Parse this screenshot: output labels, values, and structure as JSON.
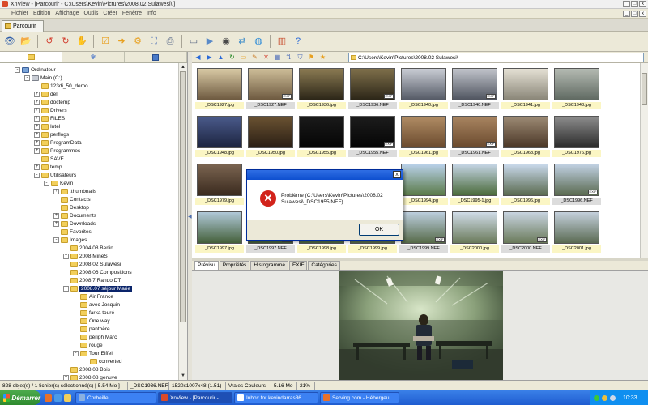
{
  "window": {
    "title": "XnView - [Parcourir - C:\\Users\\Kevin\\Pictures\\2008.02 Sulawesi\\.]",
    "min": "_",
    "max": "□",
    "close": "x"
  },
  "menu": [
    "Fichier",
    "Edition",
    "Affichage",
    "Outils",
    "Créer",
    "Fenêtre",
    "Info"
  ],
  "tab": {
    "label": "Parcourir"
  },
  "toolbar_icons": [
    "eye-icon",
    "folder-open-icon",
    "rotate-left-icon",
    "rotate-right-icon",
    "hand-icon",
    "checklist-icon",
    "folder-arrow-icon",
    "gear-icon",
    "fullscreen-icon",
    "printer-icon",
    "scanner-icon",
    "slideshow-icon",
    "camera-icon",
    "convert-icon",
    "globe-icon",
    "panel-icon",
    "help-icon"
  ],
  "left_tabs": [
    "folder-tree-icon",
    "snowflake-icon",
    "library-icon"
  ],
  "tree": [
    {
      "label": "Ordinateur",
      "depth": 0,
      "exp": "-",
      "type": "computer"
    },
    {
      "label": "Main (C:)",
      "depth": 1,
      "exp": "-",
      "type": "drive"
    },
    {
      "label": "123di_50_demo",
      "depth": 2,
      "exp": "",
      "type": "folder"
    },
    {
      "label": "dell",
      "depth": 2,
      "exp": "+",
      "type": "folder"
    },
    {
      "label": "doctemp",
      "depth": 2,
      "exp": "+",
      "type": "folder"
    },
    {
      "label": "Drivers",
      "depth": 2,
      "exp": "+",
      "type": "folder"
    },
    {
      "label": "FILES",
      "depth": 2,
      "exp": "+",
      "type": "folder"
    },
    {
      "label": "Intel",
      "depth": 2,
      "exp": "+",
      "type": "folder"
    },
    {
      "label": "perflogs",
      "depth": 2,
      "exp": "+",
      "type": "folder"
    },
    {
      "label": "ProgramData",
      "depth": 2,
      "exp": "+",
      "type": "folder"
    },
    {
      "label": "Programmes",
      "depth": 2,
      "exp": "+",
      "type": "folder"
    },
    {
      "label": "SAVE",
      "depth": 2,
      "exp": "",
      "type": "folder"
    },
    {
      "label": "temp",
      "depth": 2,
      "exp": "+",
      "type": "folder"
    },
    {
      "label": "Utilisateurs",
      "depth": 2,
      "exp": "-",
      "type": "folder"
    },
    {
      "label": "Kevin",
      "depth": 3,
      "exp": "-",
      "type": "folder"
    },
    {
      "label": ".thumbnails",
      "depth": 4,
      "exp": "+",
      "type": "folder"
    },
    {
      "label": "Contacts",
      "depth": 4,
      "exp": "",
      "type": "folder"
    },
    {
      "label": "Desktop",
      "depth": 4,
      "exp": "",
      "type": "folder"
    },
    {
      "label": "Documents",
      "depth": 4,
      "exp": "+",
      "type": "folder"
    },
    {
      "label": "Downloads",
      "depth": 4,
      "exp": "+",
      "type": "folder"
    },
    {
      "label": "Favorites",
      "depth": 4,
      "exp": "",
      "type": "folder"
    },
    {
      "label": "Images",
      "depth": 4,
      "exp": "-",
      "type": "folder"
    },
    {
      "label": "2004.08 Berlin",
      "depth": 5,
      "exp": "",
      "type": "folder"
    },
    {
      "label": "2008 MineS",
      "depth": 5,
      "exp": "+",
      "type": "folder"
    },
    {
      "label": "2008.02 Sulawesi",
      "depth": 5,
      "exp": "",
      "type": "folder"
    },
    {
      "label": "2008.06 Compositions",
      "depth": 5,
      "exp": "",
      "type": "folder"
    },
    {
      "label": "2008.7 Rando DT",
      "depth": 5,
      "exp": "",
      "type": "folder"
    },
    {
      "label": "2008.07 séjour Marie",
      "depth": 5,
      "exp": "-",
      "type": "folder",
      "selected": true
    },
    {
      "label": "Air France",
      "depth": 6,
      "exp": "",
      "type": "folder"
    },
    {
      "label": "avec Josquin",
      "depth": 6,
      "exp": "",
      "type": "folder"
    },
    {
      "label": "farka touré",
      "depth": 6,
      "exp": "",
      "type": "folder"
    },
    {
      "label": "One way",
      "depth": 6,
      "exp": "",
      "type": "folder"
    },
    {
      "label": "panthère",
      "depth": 6,
      "exp": "",
      "type": "folder"
    },
    {
      "label": "périph Marc",
      "depth": 6,
      "exp": "",
      "type": "folder"
    },
    {
      "label": "rouge",
      "depth": 6,
      "exp": "",
      "type": "folder"
    },
    {
      "label": "Tour Eiffel",
      "depth": 6,
      "exp": "-",
      "type": "folder"
    },
    {
      "label": "converted",
      "depth": 7,
      "exp": "",
      "type": "folder"
    },
    {
      "label": "2008.08 Bois",
      "depth": 5,
      "exp": "",
      "type": "folder"
    },
    {
      "label": "2008.08 genuve",
      "depth": 5,
      "exp": "+",
      "type": "folder"
    }
  ],
  "nav": {
    "icons": [
      "back-arrow-icon",
      "forward-arrow-icon",
      "up-arrow-icon",
      "refresh-icon",
      "new-folder-icon",
      "edit-icon",
      "delete-icon",
      "view-mode-icon",
      "sort-icon",
      "filter-icon",
      "bookmark-icon",
      "favorites-icon"
    ],
    "path": "C:\\Users\\Kevin\\Pictures\\2008.02 Sulawesi\\"
  },
  "thumbnails": [
    {
      "name": "_DSC1927.jpg",
      "ext": "jpg",
      "c1": "#6e5a40",
      "c2": "#d8c9a4",
      "exif": false
    },
    {
      "name": "_DSC1927.NEF",
      "ext": "nef",
      "c1": "#6e5a40",
      "c2": "#cdbd98",
      "exif": true
    },
    {
      "name": "_DSC1936.jpg",
      "ext": "jpg",
      "c1": "#2c2618",
      "c2": "#8a7a52",
      "exif": false
    },
    {
      "name": "_DSC1936.NEF",
      "ext": "nef",
      "c1": "#2c2618",
      "c2": "#7e6f4a",
      "exif": true
    },
    {
      "name": "_DSC1940.jpg",
      "ext": "jpg",
      "c1": "#555a66",
      "c2": "#c9ccd4",
      "exif": false
    },
    {
      "name": "_DSC1940.NEF",
      "ext": "nef",
      "c1": "#505560",
      "c2": "#c0c3ca",
      "exif": true
    },
    {
      "name": "_DSC1941.jpg",
      "ext": "jpg",
      "c1": "#8a8678",
      "c2": "#e4e0d4",
      "exif": false
    },
    {
      "name": "_DSC1943.jpg",
      "ext": "jpg",
      "c1": "#606a62",
      "c2": "#b4bab2",
      "exif": false
    },
    {
      "name": "_DSC1948.jpg",
      "ext": "jpg",
      "c1": "#1c2440",
      "c2": "#4a5a8a",
      "exif": false
    },
    {
      "name": "_DSC1950.jpg",
      "ext": "jpg",
      "c1": "#2a1e14",
      "c2": "#6a5232",
      "exif": false
    },
    {
      "name": "_DSC1955.jpg",
      "ext": "jpg",
      "c1": "#050505",
      "c2": "#1a1a1a",
      "exif": false
    },
    {
      "name": "_DSC1955.NEF",
      "ext": "nef",
      "c1": "#050505",
      "c2": "#1c1c1c",
      "exif": true
    },
    {
      "name": "_DSC1961.jpg",
      "ext": "jpg",
      "c1": "#6a4a2e",
      "c2": "#b08c64",
      "exif": false
    },
    {
      "name": "_DSC1961.NEF",
      "ext": "nef",
      "c1": "#6a4a2e",
      "c2": "#a88460",
      "exif": true
    },
    {
      "name": "_DSC1968.jpg",
      "ext": "jpg",
      "c1": "#4a3626",
      "c2": "#9c8a74",
      "exif": false
    },
    {
      "name": "_DSC1976.jpg",
      "ext": "jpg",
      "c1": "#2a2a2a",
      "c2": "#8c8c8c",
      "exif": false
    },
    {
      "name": "_DSC1979.jpg",
      "ext": "jpg",
      "c1": "#3a2a1e",
      "c2": "#7a6450",
      "exif": false
    },
    {
      "name": "",
      "ext": "hidden",
      "c1": "#ffffff",
      "c2": "#ffffff",
      "exif": false
    },
    {
      "name": "",
      "ext": "hidden",
      "c1": "#ffffff",
      "c2": "#ffffff",
      "exif": false
    },
    {
      "name": "",
      "ext": "hidden",
      "c1": "#ffffff",
      "c2": "#ffffff",
      "exif": false
    },
    {
      "name": "_DSC1994.jpg",
      "ext": "jpg",
      "c1": "#5a7a48",
      "c2": "#b8d0e8",
      "exif": false
    },
    {
      "name": "_DSC1995-1.jpg",
      "ext": "jpg",
      "c1": "#4a6a3a",
      "c2": "#c4d4e4",
      "exif": false
    },
    {
      "name": "_DSC1996.jpg",
      "ext": "jpg",
      "c1": "#5a6a50",
      "c2": "#c8d8ea",
      "exif": false
    },
    {
      "name": "_DSC1996.NEF",
      "ext": "nef",
      "c1": "#5a6a50",
      "c2": "#c0d0e2",
      "exif": true
    },
    {
      "name": "_DSC1997.jpg",
      "ext": "jpg",
      "c1": "#44603a",
      "c2": "#b0c8d8",
      "exif": false
    },
    {
      "name": "_DSC1997.NEF",
      "ext": "nef",
      "c1": "#44603a",
      "c2": "#a8c0d0",
      "exif": true
    },
    {
      "name": "_DSC1998.jpg",
      "ext": "jpg",
      "c1": "#4c6640",
      "c2": "#bcd0e0",
      "exif": false
    },
    {
      "name": "_DSC1999.jpg",
      "ext": "jpg",
      "c1": "#566a48",
      "c2": "#c4d6e6",
      "exif": false
    },
    {
      "name": "_DSC1999.NEF",
      "ext": "nef",
      "c1": "#566a48",
      "c2": "#bccede",
      "exif": true
    },
    {
      "name": "_DSC2000.jpg",
      "ext": "jpg",
      "c1": "#6a7a5a",
      "c2": "#d0dce8",
      "exif": false
    },
    {
      "name": "_DSC2000.NEF",
      "ext": "nef",
      "c1": "#6a7a5a",
      "c2": "#c8d4e0",
      "exif": true
    },
    {
      "name": "_DSC2001.jpg",
      "ext": "jpg",
      "c1": "#5a6a52",
      "c2": "#c4d0dc",
      "exif": false
    }
  ],
  "exif_label": "EXIF",
  "preview_tabs": [
    "Prévisu",
    "Propriétés",
    "Histogramme",
    "EXIF",
    "Catégories"
  ],
  "dialog": {
    "message": "Problème (C:\\Users\\Kevin\\Pictures\\2008.02 Sulawesi\\_DSC1955.NEF)",
    "ok": "OK",
    "close": "x",
    "error_glyph": "✕"
  },
  "status": [
    "828 objet(s) / 1 fichier(s) sélectionné(s)  [ 5.54 Mo ]",
    "_DSC1936.NEF",
    "1520x1007x48 (1.51)",
    "Vraies Couleurs",
    "5.16 Mo",
    "21%"
  ],
  "taskbar": {
    "start": "Démarrer",
    "tasks": [
      {
        "label": "Corbeille",
        "color": "#8ab0e0"
      },
      {
        "label": "XnView - [Parcourir - ...",
        "color": "#d94a2b",
        "active": true
      },
      {
        "label": "Inbox for kevindarras86...",
        "color": "#ffffff"
      },
      {
        "label": "Serving.com - Hébergeu...",
        "color": "#e8702a"
      }
    ],
    "clock": "10:33"
  },
  "colors": {
    "selection": "#0a246a",
    "titlebar_dialog": "#0e4fcf",
    "error_red": "#d2231b",
    "caption_jpg": "#fbf6c4",
    "caption_raw": "#dcdcdc"
  }
}
